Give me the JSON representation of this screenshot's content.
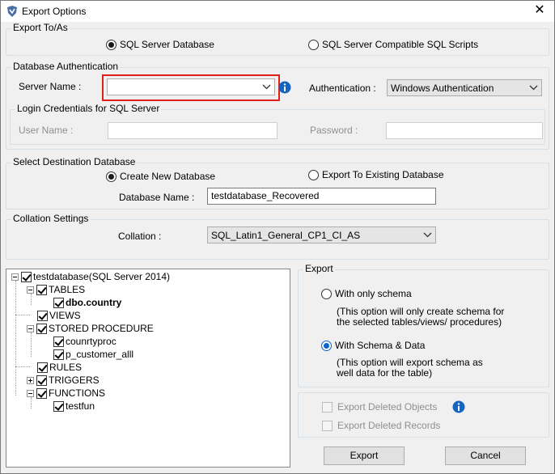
{
  "window": {
    "title": "Export Options"
  },
  "export_to": {
    "legend": "Export To/As",
    "options": [
      {
        "label": "SQL Server Database",
        "selected": true
      },
      {
        "label": "SQL Server Compatible SQL Scripts",
        "selected": false
      }
    ]
  },
  "db_auth": {
    "legend": "Database Authentication",
    "server_name_label": "Server Name :",
    "server_name_value": "",
    "authentication_label": "Authentication :",
    "authentication_value": "Windows Authentication",
    "login": {
      "legend": "Login Credentials for SQL Server",
      "user_name_label": "User Name :",
      "user_name_value": "",
      "password_label": "Password :",
      "password_value": ""
    }
  },
  "destination": {
    "legend": "Select Destination Database",
    "options": [
      {
        "label": "Create New Database",
        "selected": true
      },
      {
        "label": "Export To Existing Database",
        "selected": false
      }
    ],
    "db_name_label": "Database Name :",
    "db_name_value": "testdatabase_Recovered"
  },
  "collation": {
    "legend": "Collation Settings",
    "label": "Collation :",
    "value": "SQL_Latin1_General_CP1_CI_AS"
  },
  "tree": {
    "root": "testdatabase(SQL Server 2014)",
    "tables": "TABLES",
    "table_items": [
      "dbo.country"
    ],
    "views": "VIEWS",
    "stored_procedure": "STORED PROCEDURE",
    "sp_items": [
      "counrtyproc",
      "p_customer_alll"
    ],
    "rules": "RULES",
    "triggers": "TRIGGERS",
    "functions": "FUNCTIONS",
    "function_items": [
      "testfun"
    ]
  },
  "export": {
    "legend": "Export",
    "schema_only_label": "With only schema",
    "schema_only_note_1": "(This option will only create schema for",
    "schema_only_note_2": "the  selected tables/views/ procedures)",
    "schema_data_label": "With Schema & Data",
    "schema_data_note_1": "(This option will export schema as",
    "schema_data_note_2": "well data for the table)",
    "selected": "schema_data"
  },
  "deleted": {
    "objects_label": "Export Deleted Objects",
    "records_label": "Export Deleted Records"
  },
  "buttons": {
    "export": "Export",
    "cancel": "Cancel"
  },
  "colors": {
    "highlight": "#e0201b",
    "info": "#1565c0",
    "radio_blue": "#0a63c9"
  }
}
